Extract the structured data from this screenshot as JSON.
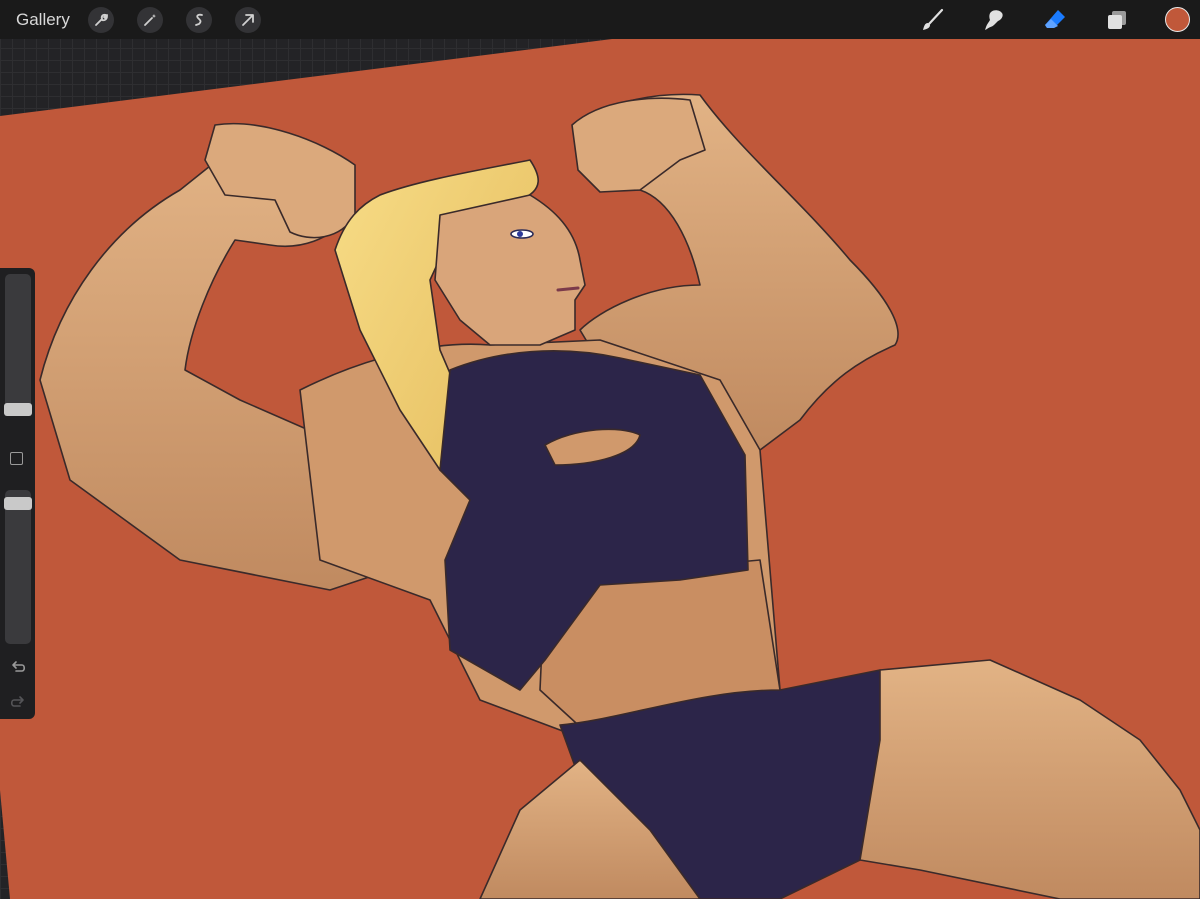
{
  "topbar": {
    "gallery_label": "Gallery",
    "left_tools": [
      "wrench-icon",
      "magic-wand-icon",
      "selection-icon",
      "transform-arrow-icon"
    ],
    "right_tools": [
      "brush-icon",
      "smudge-icon",
      "eraser-icon",
      "layers-icon"
    ],
    "active_tool": "eraser",
    "active_tool_color": "#1a7bff",
    "current_color": "#c0583a"
  },
  "sidebar": {
    "brush_size_level": 0.87,
    "opacity_level": 0.05,
    "icons": [
      "modify-square-icon",
      "undo-icon",
      "redo-icon"
    ]
  },
  "canvas": {
    "background_color": "#c0583a",
    "skin_color": "#d4a074",
    "hair_color": "#f0cc6e",
    "outfit_color": "#2c2549"
  }
}
